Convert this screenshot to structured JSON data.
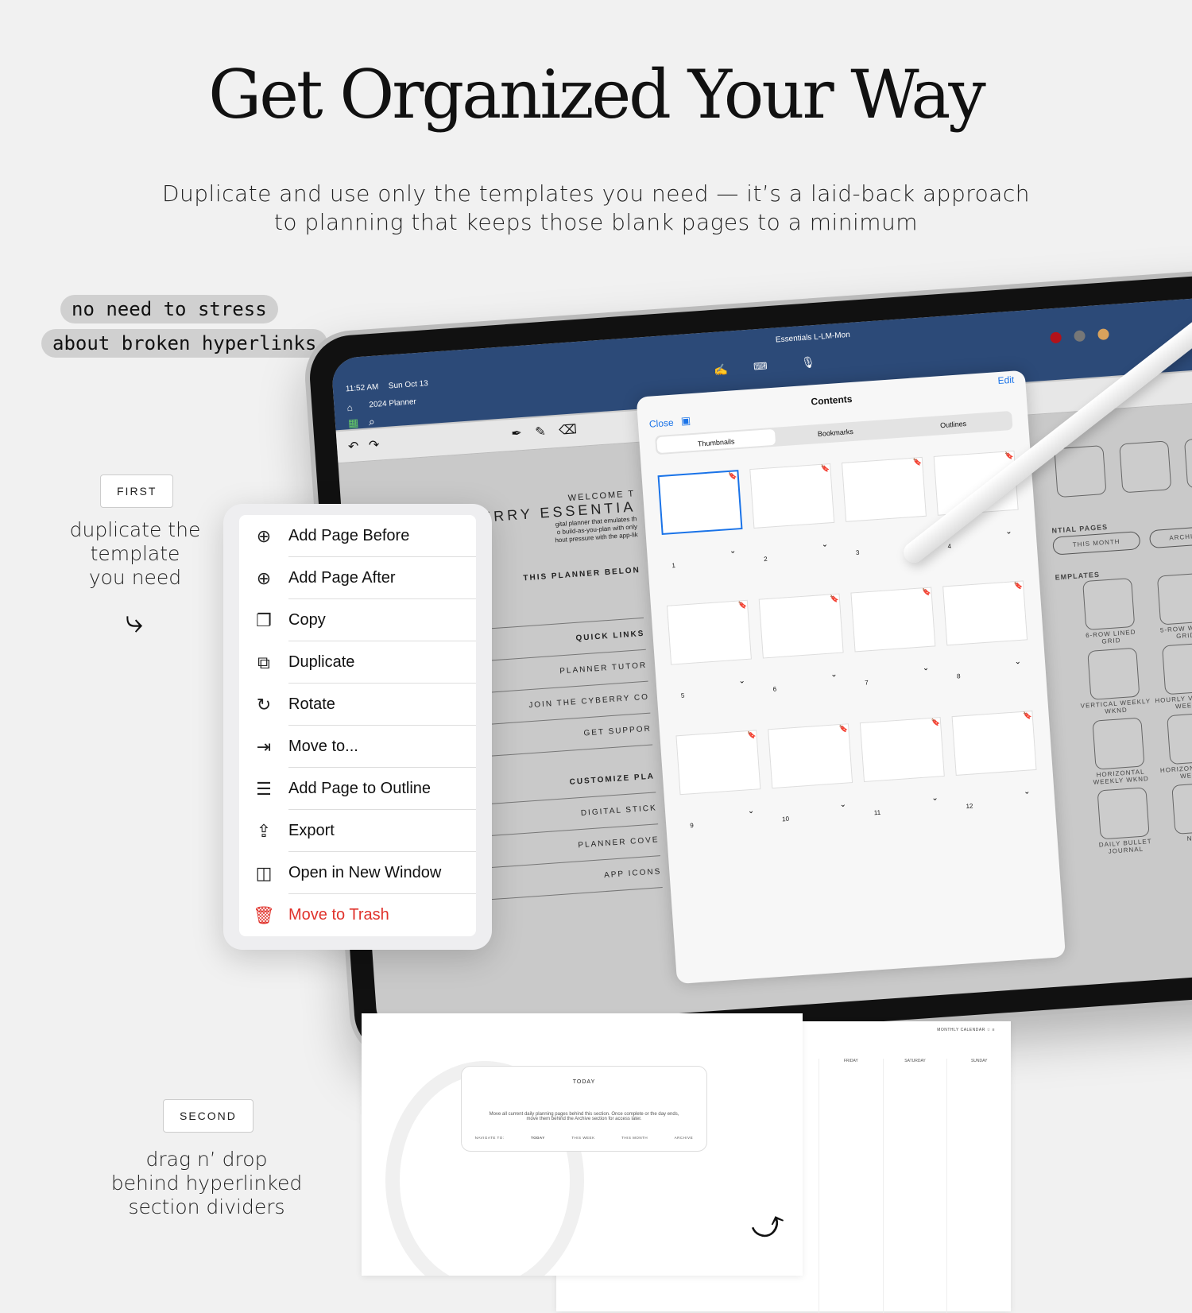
{
  "headline": "Get Organized Your Way",
  "subtitle": [
    "Duplicate and use only the templates you need — it’s a laid-back approach",
    "to planning that keeps those blank pages to a minimum"
  ],
  "callout": [
    "no need to stress",
    "about broken hyperlinks"
  ],
  "step1": {
    "tag": "FIRST",
    "text": [
      "duplicate the",
      "template",
      "you need"
    ]
  },
  "step2": {
    "tag": "SECOND",
    "text": [
      "drag n’ drop",
      "behind hyperlinked",
      "section dividers"
    ]
  },
  "tablet": {
    "time": "11:52 AM",
    "date": "Sun Oct 13",
    "doc_title": "2024 Planner",
    "tab_title": "Essentials L-LM-Mon",
    "planner_page": {
      "welcome": "WELCOME T",
      "name": "ERRY ESSENTIA",
      "intro": [
        "gital planner that emulates th",
        "o build-as-you-plan with only",
        "hout pressure with the app-lik"
      ],
      "links": [
        "THIS PLANNER BELON",
        "QUICK LINKS",
        "PLANNER TUTOR",
        "JOIN THE CYBERRY CO",
        "GET SUPPOR",
        "CUSTOMIZE PLA",
        "DIGITAL STICK",
        "PLANNER COVE",
        "APP ICONS"
      ]
    },
    "right_page": {
      "essential_heading": "NTIAL PAGES",
      "essential_buttons": [
        "THIS MONTH",
        "ARCHIV"
      ],
      "templates_heading": "EMPLATES",
      "templates": [
        "6-ROW LINED GRID",
        "5-ROW WKND GRID",
        "VERTICAL WEEKLY WKND",
        "HOURLY VERTICAL WEEKLY",
        "HORIZONTAL WEEKLY WKND",
        "HORIZONTAL GRID WEEKLY",
        "DAILY BULLET JOURNAL",
        "NOTES"
      ]
    },
    "colors": [
      "#b3121a",
      "#777777",
      "#d9a25c",
      "#e6e6e6"
    ]
  },
  "contents": {
    "title": "Contents",
    "close": "Close",
    "edit": "Edit",
    "tabs": [
      "Thumbnails",
      "Bookmarks",
      "Outlines"
    ],
    "active_tab": "Thumbnails",
    "thumbnails": [
      "1",
      "2",
      "3",
      "4",
      "5",
      "6",
      "7",
      "8",
      "9",
      "10",
      "11",
      "12"
    ],
    "selected": "1"
  },
  "context_menu": [
    {
      "label": "Add Page Before",
      "icon": "add-page-before-icon",
      "glyph": "⊕"
    },
    {
      "label": "Add Page After",
      "icon": "add-page-after-icon",
      "glyph": "⊕"
    },
    {
      "label": "Copy",
      "icon": "copy-icon",
      "glyph": "❐"
    },
    {
      "label": "Duplicate",
      "icon": "duplicate-icon",
      "glyph": "⧉"
    },
    {
      "label": "Rotate",
      "icon": "rotate-icon",
      "glyph": "↻"
    },
    {
      "label": "Move to...",
      "icon": "move-icon",
      "glyph": "⇥"
    },
    {
      "label": "Add Page to Outline",
      "icon": "outline-icon",
      "glyph": "☰"
    },
    {
      "label": "Export",
      "icon": "export-icon",
      "glyph": "⇪"
    },
    {
      "label": "Open in New Window",
      "icon": "split-window-icon",
      "glyph": "◫"
    },
    {
      "label": "Move to Trash",
      "icon": "trash-icon",
      "glyph": "🗑",
      "destructive": true
    }
  ],
  "bottom_today": {
    "title": "TODAY",
    "desc": [
      "Move all current daily planning pages behind this section. Once complete or the day ends,",
      "move them behind the Archive section for access later."
    ],
    "nav": [
      "NAVIGATE TO:",
      "TODAY",
      "THIS WEEK",
      "THIS MONTH",
      "ARCHIVE"
    ]
  },
  "bottom_calendar": {
    "header": "MONTHLY CALENDAR",
    "days": [
      "FRIDAY",
      "SATURDAY",
      "SUNDAY"
    ]
  }
}
